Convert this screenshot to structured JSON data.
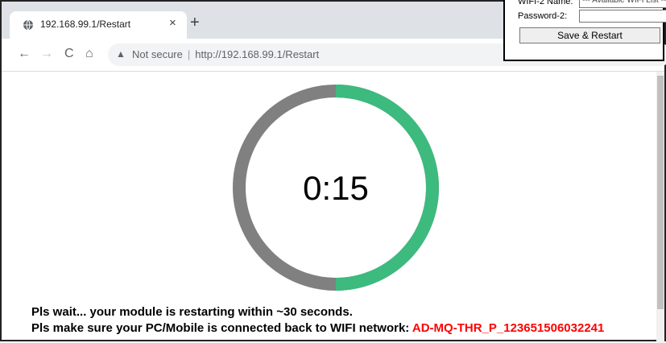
{
  "browser": {
    "tab": {
      "title": "192.168.99.1/Restart",
      "close": "×"
    },
    "new_tab": "+",
    "nav": {
      "back": "←",
      "forward": "→",
      "reload": "C",
      "home": "⌂"
    },
    "omnibox": {
      "security_label": "Not secure",
      "separator": "|",
      "url": "http://192.168.99.1/Restart"
    }
  },
  "timer": {
    "display": "0:15",
    "remaining_seconds": 15,
    "total_seconds": 30,
    "progress_color": "#3dba7e",
    "track_color": "#808080"
  },
  "messages": {
    "line1": "Pls wait... your module is restarting within ~30 seconds.",
    "line2_prefix": "Pls make sure your PC/Mobile is connected back to WIFI network: ",
    "network_name": "AD-MQ-THR_P_123651506032241"
  },
  "popup": {
    "wifi2_label": "WIFI-2 Name:",
    "wifi2_value": "--- Available WIFI List ---",
    "password2_label": "Password-2:",
    "password2_value": "",
    "save_button": "Save & Restart"
  }
}
